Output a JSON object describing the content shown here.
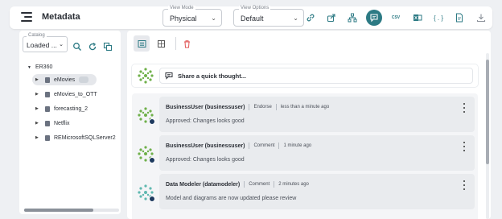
{
  "header": {
    "title": "Metadata",
    "view_mode": {
      "label": "View Mode",
      "value": "Physical"
    },
    "view_options": {
      "label": "View Options",
      "value": "Default"
    },
    "csv_label": "CSV",
    "json_label": "{ . }",
    "toolbar_icons": [
      "link-icon",
      "share-icon",
      "hierarchy-icon",
      "comments-icon",
      "csv-export-icon",
      "excel-icon",
      "json-icon",
      "pdf-icon",
      "download-icon"
    ],
    "active_icon": "comments-icon",
    "accent_color": "#2c7a84"
  },
  "left_panel": {
    "catalog": {
      "label": "Catalog",
      "value": "Loaded ..."
    },
    "tree": {
      "root": "ER360",
      "items": [
        {
          "label": "eMovies",
          "selected": true
        },
        {
          "label": "eMovies_to_OTT",
          "selected": false
        },
        {
          "label": "forecasting_2",
          "selected": false
        },
        {
          "label": "Netflix",
          "selected": false
        },
        {
          "label": "REMicrosoftSQLServer2",
          "selected": false
        }
      ]
    }
  },
  "main": {
    "compose_placeholder": "Share a quick thought...",
    "comments": [
      {
        "user": "BusinessUser (businessuser)",
        "action": "Endorse",
        "time": "less than a minute ago",
        "message": "Approved: Changes looks good"
      },
      {
        "user": "BusinessUser (businessuser)",
        "action": "Comment",
        "time": "1 minute ago",
        "message": "Approved: Changes looks good"
      },
      {
        "user": "Data Modeler (datamodeler)",
        "action": "Comment",
        "time": "2 minutes ago",
        "message": "Model and diagrams are now updated please review"
      }
    ]
  }
}
